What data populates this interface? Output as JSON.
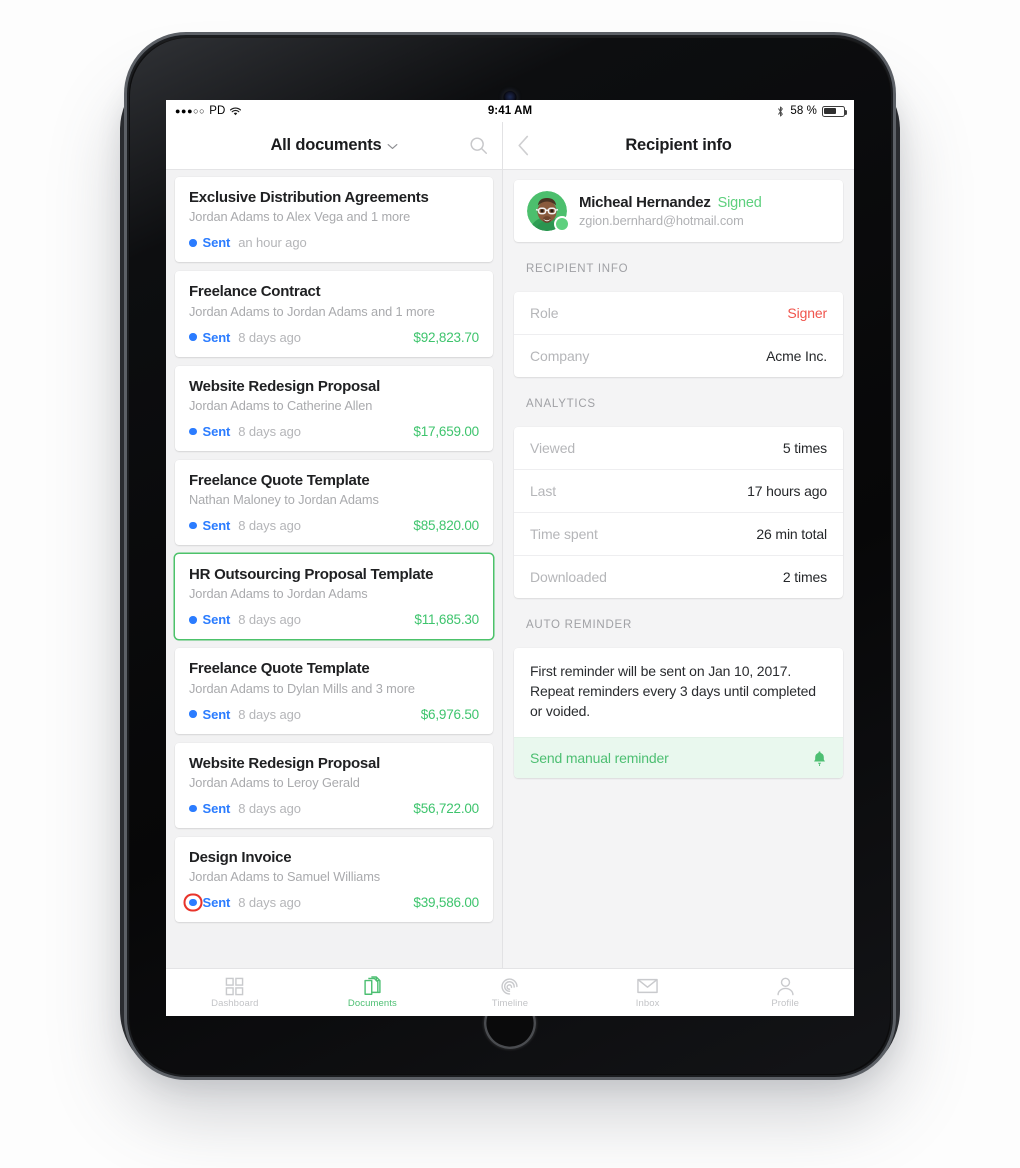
{
  "status_bar": {
    "signal_dots": "●●●○○",
    "carrier": "PD",
    "wifi_icon": "wifi-icon",
    "time": "9:41 AM",
    "bluetooth_icon": "bluetooth-icon",
    "battery_percent": "58 %",
    "battery_icon": "battery-icon"
  },
  "left_pane": {
    "navbar": {
      "title": "All documents",
      "chevron": "ˇ",
      "search_icon": "search-icon"
    },
    "documents": [
      {
        "title": "Exclusive Distribution Agreements",
        "participants": "Jordan Adams to Alex Vega and 1 more",
        "status": "Sent",
        "time": "an hour ago",
        "amount": "",
        "selected": false,
        "tapped": false
      },
      {
        "title": "Freelance Contract",
        "participants": "Jordan Adams to Jordan Adams and 1 more",
        "status": "Sent",
        "time": "8 days ago",
        "amount": "$92,823.70",
        "selected": false,
        "tapped": false
      },
      {
        "title": "Website Redesign Proposal",
        "participants": "Jordan Adams to Catherine Allen",
        "status": "Sent",
        "time": "8 days ago",
        "amount": "$17,659.00",
        "selected": false,
        "tapped": false
      },
      {
        "title": "Freelance Quote Template",
        "participants": "Nathan Maloney to Jordan Adams",
        "status": "Sent",
        "time": "8 days ago",
        "amount": "$85,820.00",
        "selected": false,
        "tapped": false
      },
      {
        "title": "HR Outsourcing Proposal Template",
        "participants": "Jordan Adams to Jordan Adams",
        "status": "Sent",
        "time": "8 days ago",
        "amount": "$11,685.30",
        "selected": true,
        "tapped": false
      },
      {
        "title": "Freelance Quote Template",
        "participants": "Jordan Adams to Dylan Mills and 3 more",
        "status": "Sent",
        "time": "8 days ago",
        "amount": "$6,976.50",
        "selected": false,
        "tapped": false
      },
      {
        "title": "Website Redesign Proposal",
        "participants": "Jordan Adams to Leroy Gerald",
        "status": "Sent",
        "time": "8 days ago",
        "amount": "$56,722.00",
        "selected": false,
        "tapped": false
      },
      {
        "title": "Design Invoice",
        "participants": "Jordan Adams to Samuel Williams",
        "status": "Sent",
        "time": "8 days ago",
        "amount": "$39,586.00",
        "selected": false,
        "tapped": true
      }
    ]
  },
  "right_pane": {
    "navbar": {
      "title": "Recipient info",
      "back_icon": "chevron-left-icon"
    },
    "person": {
      "avatar": "avatar-photo",
      "name": "Micheal Hernandez",
      "state": "Signed",
      "email": "zgion.bernhard@hotmail.com",
      "online_indicator": "online-status-dot"
    },
    "sections": [
      {
        "heading": "RECIPIENT INFO",
        "rows": [
          {
            "key": "Role",
            "value": "Signer",
            "accent": "red"
          },
          {
            "key": "Company",
            "value": "Acme Inc.",
            "accent": ""
          }
        ]
      },
      {
        "heading": "ANALYTICS",
        "rows": [
          {
            "key": "Viewed",
            "value": "5 times",
            "accent": ""
          },
          {
            "key": "Last",
            "value": "17 hours ago",
            "accent": ""
          },
          {
            "key": "Time spent",
            "value": "26 min total",
            "accent": ""
          },
          {
            "key": "Downloaded",
            "value": "2 times",
            "accent": ""
          }
        ]
      }
    ],
    "auto_reminder": {
      "heading": "AUTO REMINDER",
      "text": "First reminder will be sent on Jan 10, 2017. Repeat reminders every 3 days until completed or voided.",
      "action_label": "Send manual reminder",
      "action_icon": "bell-icon"
    }
  },
  "tabbar": {
    "tabs": [
      {
        "label": "Dashboard",
        "icon": "grid-icon",
        "active": false
      },
      {
        "label": "Documents",
        "icon": "documents-icon",
        "active": true
      },
      {
        "label": "Timeline",
        "icon": "spiral-icon",
        "active": false
      },
      {
        "label": "Inbox",
        "icon": "envelope-icon",
        "active": false
      },
      {
        "label": "Profile",
        "icon": "person-icon",
        "active": false
      }
    ]
  },
  "colors": {
    "accent_green": "#4dbf72",
    "status_blue": "#2b7cff",
    "amount_green": "#3ec46d",
    "role_red": "#f0544c",
    "tap_ring_red": "#e8342b"
  }
}
